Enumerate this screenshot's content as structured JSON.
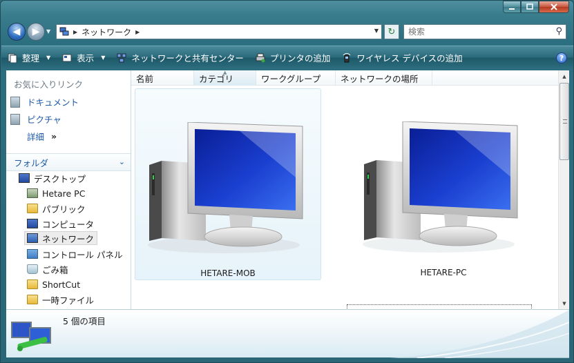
{
  "window": {
    "caption_buttons": [
      "minimize",
      "maximize",
      "close"
    ]
  },
  "nav": {
    "breadcrumb": "ネットワーク",
    "search_placeholder": "検索"
  },
  "toolbar": {
    "organize": "整理",
    "view": "表示",
    "network_center": "ネットワークと共有センター",
    "add_printer": "プリンタの追加",
    "add_wireless": "ワイヤレス デバイスの追加"
  },
  "sidebar": {
    "favorites_title": "お気に入りリンク",
    "favorites": [
      {
        "label": "ドキュメント"
      },
      {
        "label": "ピクチャ"
      }
    ],
    "more_label": "詳細",
    "folders_title": "フォルダ",
    "tree": [
      {
        "label": "デスクトップ",
        "icon": "desktop-icon"
      },
      {
        "label": "Hetare PC",
        "icon": "user-folder-icon"
      },
      {
        "label": "パブリック",
        "icon": "folder-icon"
      },
      {
        "label": "コンピュータ",
        "icon": "computer-icon"
      },
      {
        "label": "ネットワーク",
        "icon": "network-icon",
        "selected": true
      },
      {
        "label": "コントロール パネル",
        "icon": "control-panel-icon"
      },
      {
        "label": "ごみ箱",
        "icon": "recycle-bin-icon"
      },
      {
        "label": "ShortCut",
        "icon": "folder-icon"
      },
      {
        "label": "一時ファイル",
        "icon": "folder-icon"
      }
    ]
  },
  "content": {
    "columns": [
      "名前",
      "カテゴリ",
      "ワークグループ",
      "ネットワークの場所"
    ],
    "items": [
      {
        "name": "HETARE-MOB",
        "icon": "computer-icon"
      },
      {
        "name": "HETARE-PC",
        "icon": "computer-icon"
      }
    ]
  },
  "details": {
    "count_text": "5 個の項目"
  },
  "colors": {
    "accent": "#2a6676",
    "link": "#1e5aa8"
  }
}
